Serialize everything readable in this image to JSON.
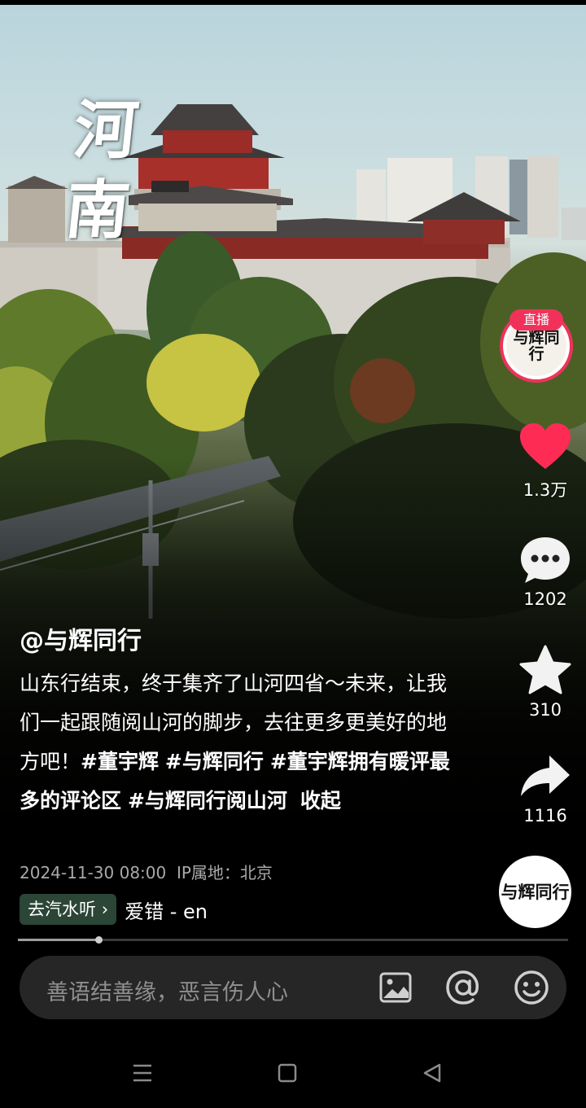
{
  "video": {
    "overlay_title": "河南"
  },
  "rail": {
    "live_badge": "直播",
    "live_avatar_text": "与辉同行",
    "likes": "1.3万",
    "comments": "1202",
    "favorites": "310",
    "shares": "1116",
    "author_avatar_text": "与辉同行"
  },
  "caption": {
    "username": "@与辉同行",
    "text": "山东行结束，终于集齐了山河四省～未来，让我们一起跟随阅山河的脚步，去往更多更美好的地方吧！",
    "tags": [
      "#董宇辉",
      "#与辉同行",
      "#董宇辉拥有暖评最多的评论区",
      "#与辉同行阅山河"
    ],
    "collapse": "收起",
    "date": "2024-11-30 08:00",
    "ip_location": "IP属地：北京"
  },
  "music": {
    "button": "去汽水听",
    "track": "爱错 - en"
  },
  "progress": {
    "value": 0.146
  },
  "comment_bar": {
    "placeholder": "善语结善缘，恶言伤人心"
  },
  "colors": {
    "like": "#fe2c55",
    "live_ring": "#f0325a",
    "music_btn": "#2b4536"
  },
  "icons": [
    "heart-icon",
    "comment-icon",
    "star-icon",
    "share-icon",
    "image-icon",
    "at-icon",
    "emoji-icon",
    "menu-icon",
    "home-icon",
    "back-icon"
  ]
}
